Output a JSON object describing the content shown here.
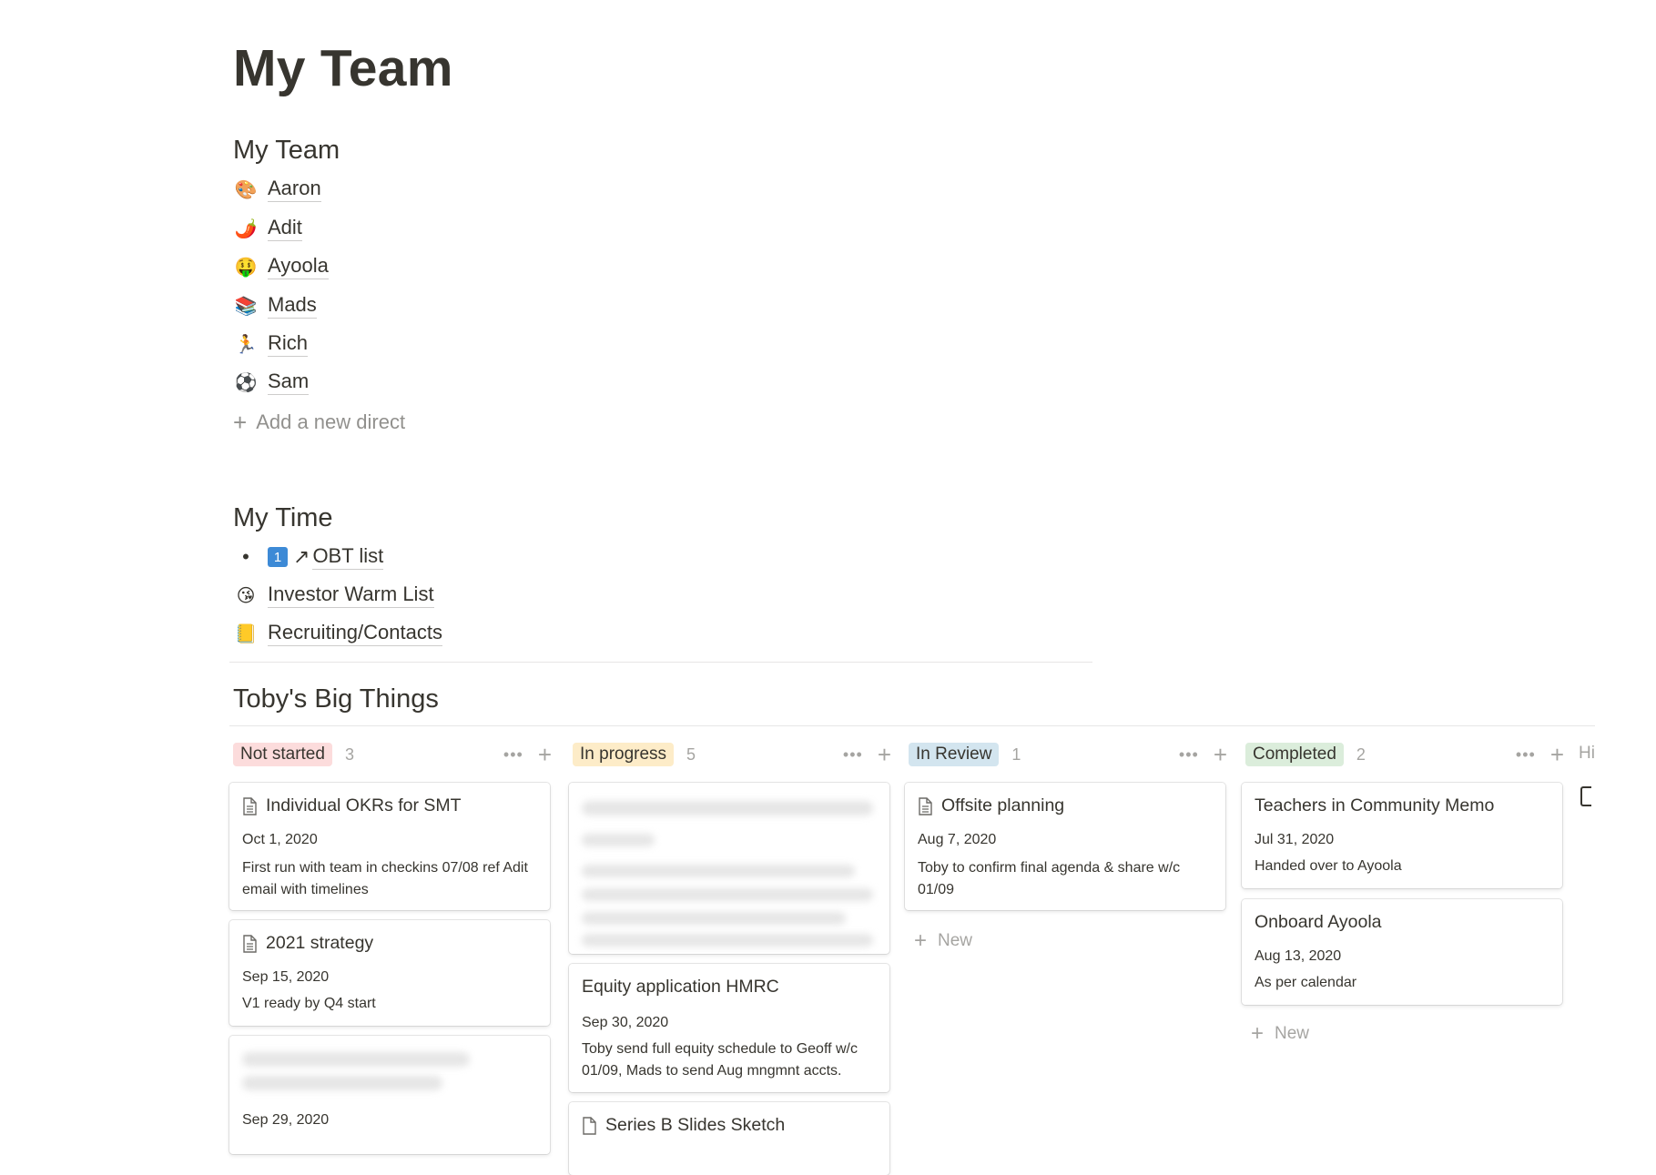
{
  "page": {
    "title": "My Team"
  },
  "team": {
    "heading": "My Team",
    "members": [
      {
        "emoji": "🎨",
        "name": "Aaron"
      },
      {
        "emoji": "🌶️",
        "name": "Adit"
      },
      {
        "emoji": "🤑",
        "name": "Ayoola"
      },
      {
        "emoji": "📚",
        "name": "Mads"
      },
      {
        "emoji": "🏃",
        "name": "Rich"
      },
      {
        "emoji": "⚽",
        "name": "Sam"
      }
    ],
    "add_label": "Add a new direct"
  },
  "time": {
    "heading": "My Time",
    "obt_number": "1",
    "obt_arrow": "↗",
    "obt_label": "OBT list",
    "investor_emoji": "😘",
    "investor_label": "Investor Warm List",
    "recruiting_emoji": "📒",
    "recruiting_label": "Recruiting/Contacts"
  },
  "board": {
    "heading": "Toby's Big Things",
    "hidden_label": "Hi",
    "columns": [
      {
        "label": "Not started",
        "count": "3",
        "tag_bg": "#fcdcdc",
        "cards": [
          {
            "title": "Individual OKRs for SMT",
            "date": "Oct 1, 2020",
            "note": "First run with team in checkins 07/08 ref Adit email with timelines"
          },
          {
            "title": "2021 strategy",
            "date": "Sep 15, 2020",
            "note": "V1 ready by Q4 start"
          },
          {
            "title": "",
            "date": "Sep 29, 2020",
            "note": ""
          }
        ]
      },
      {
        "label": "In progress",
        "count": "5",
        "tag_bg": "#fdecc8",
        "cards": [
          {
            "title": "",
            "date": "",
            "note": ""
          },
          {
            "title": "Equity application HMRC",
            "date": "Sep 30, 2020",
            "note": "Toby send full equity schedule to Geoff w/c 01/09, Mads to send Aug mngmnt accts."
          },
          {
            "title": "Series B Slides Sketch",
            "date": "",
            "note": ""
          }
        ]
      },
      {
        "label": "In Review",
        "count": "1",
        "tag_bg": "#d3e5ef",
        "cards": [
          {
            "title": "Offsite planning",
            "date": "Aug 7, 2020",
            "note": "Toby to confirm final agenda & share w/c 01/09"
          }
        ],
        "new_label": "New"
      },
      {
        "label": "Completed",
        "count": "2",
        "tag_bg": "#dbeddb",
        "cards": [
          {
            "title": "Teachers in Community Memo",
            "date": "Jul 31, 2020",
            "note": "Handed over to Ayoola"
          },
          {
            "title": "Onboard Ayoola",
            "date": "Aug 13, 2020",
            "note": "As per calendar"
          }
        ],
        "new_label": "New"
      }
    ]
  },
  "icons": {
    "dots": "•••",
    "plus": "+",
    "doc": "doc-icon"
  }
}
